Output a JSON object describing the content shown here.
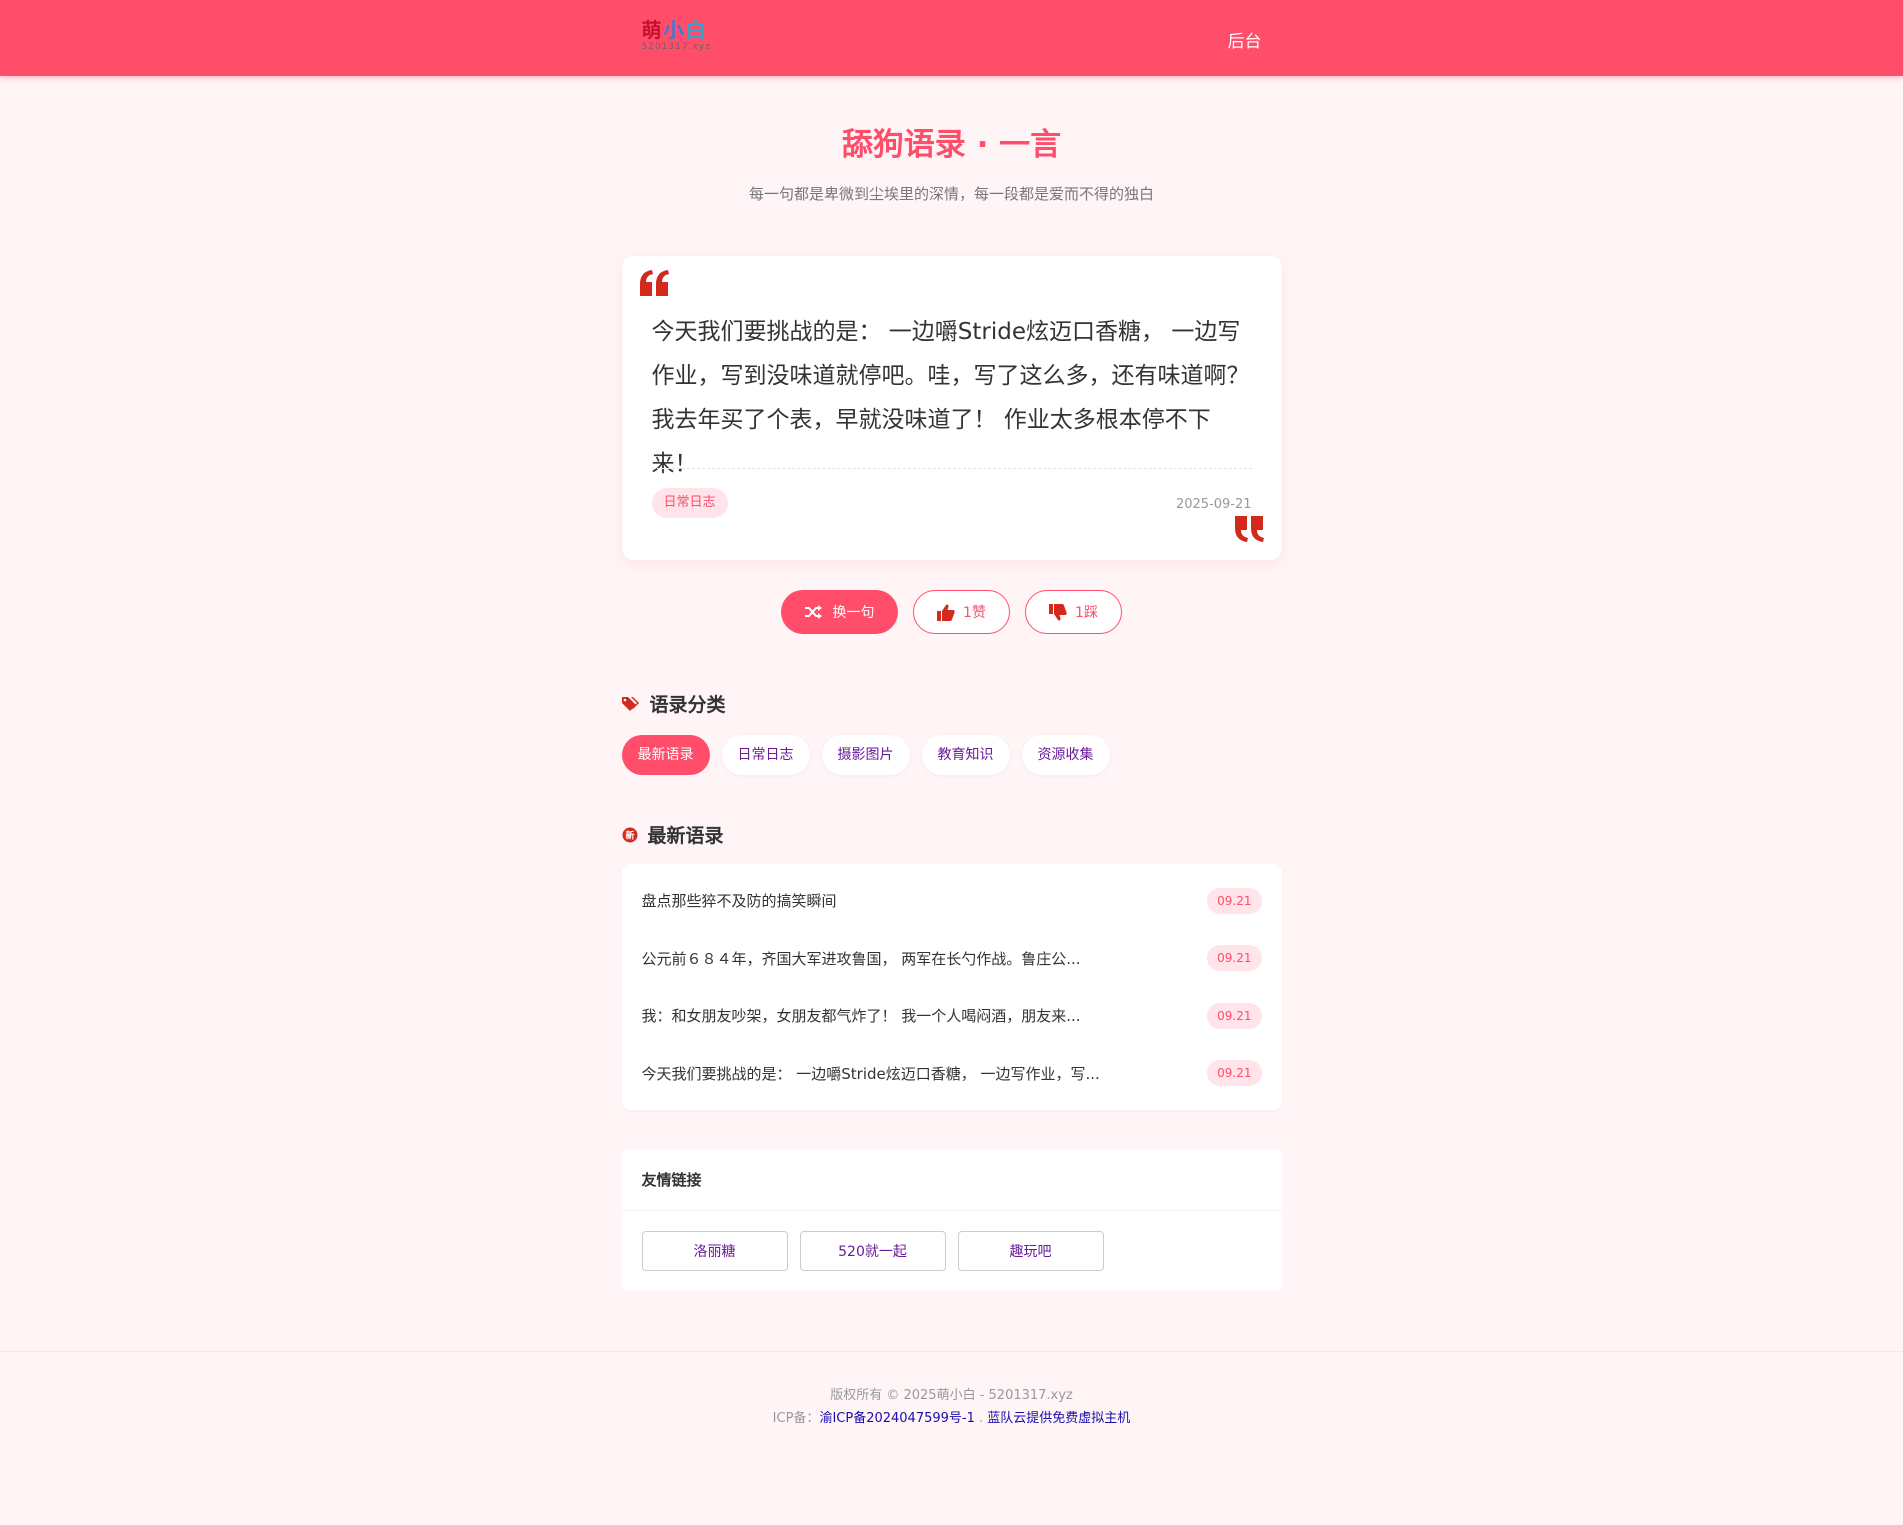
{
  "header": {
    "logo": {
      "char1": "萌",
      "char2": "小",
      "char3": "白",
      "sub": "5201317.xyz"
    },
    "admin_label": "后台",
    "brand_color": "#ff4d6a"
  },
  "hero": {
    "title": "舔狗语录 · 一言",
    "subtitle": "每一句都是卑微到尘埃里的深情，每一段都是爱而不得的独白"
  },
  "quote": {
    "text": "今天我们要挑战的是： 一边嚼Stride炫迈口香糖， 一边写作业，写到没味道就停吧。哇，写了这么多，还有味道啊？我去年买了个表，早就没味道了！ 作业太多根本停不下来！",
    "tag": "日常日志",
    "date": "2025-09-21"
  },
  "actions": {
    "shuffle_label": "换一句",
    "like_label": "1赞",
    "dislike_label": "1踩"
  },
  "categories": {
    "heading": "语录分类",
    "items": [
      "最新语录",
      "日常日志",
      "摄影图片",
      "教育知识",
      "资源收集"
    ],
    "active_index": 0
  },
  "latest": {
    "heading": "最新语录",
    "badge": "新",
    "items": [
      {
        "text": "盘点那些猝不及防的搞笑瞬间",
        "date": "09.21"
      },
      {
        "text": "公元前６８４年，齐国大军进攻鲁国， 两军在长勺作战。鲁庄公...",
        "date": "09.21"
      },
      {
        "text": "我：和女朋友吵架，女朋友都气炸了！ 我一个人喝闷酒，朋友来...",
        "date": "09.21"
      },
      {
        "text": "今天我们要挑战的是： 一边嚼Stride炫迈口香糖， 一边写作业，写...",
        "date": "09.21"
      }
    ]
  },
  "friends": {
    "heading": "友情链接",
    "links": [
      "洛丽糖",
      "520就一起",
      "趣玩吧"
    ]
  },
  "footer": {
    "copyright": "版权所有 © 2025萌小白 - 5201317.xyz",
    "icp_prefix": "ICP备：",
    "icp_link": "渝ICP备2024047599号-1",
    "sep": ".",
    "host_link": "蓝队云提供免费虚拟主机"
  }
}
